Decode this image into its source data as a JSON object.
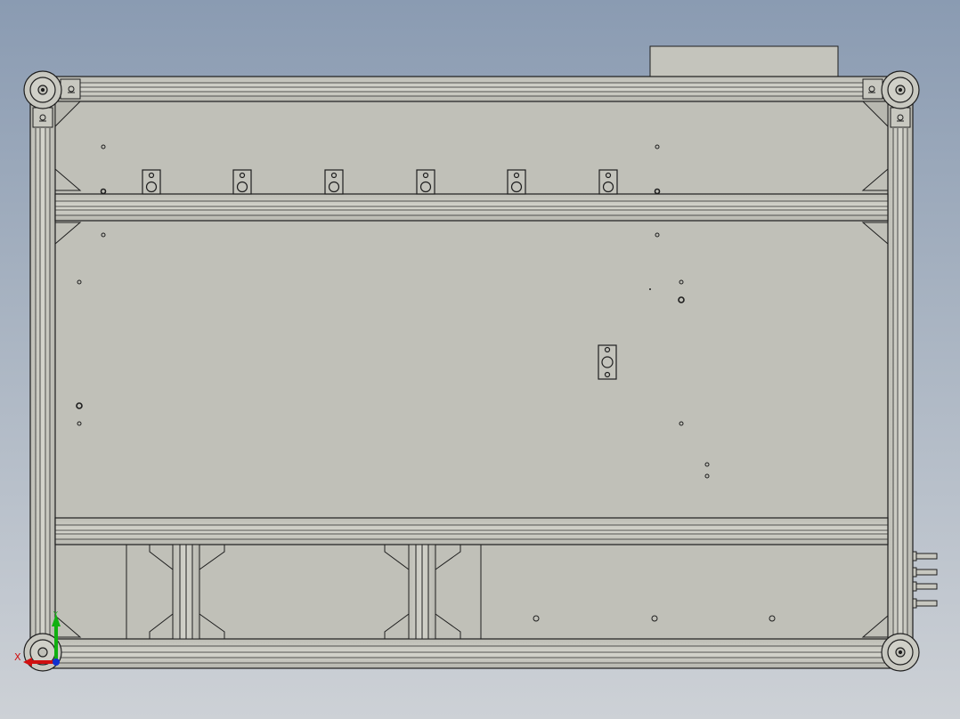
{
  "view": {
    "type": "CAD 3D model viewport - front view of aluminum extrusion frame",
    "colors": {
      "background_top": "#8a9bb2",
      "background_bottom": "#cdd1d6",
      "panel": "#c0c0b8",
      "frame": "#c8c8c0",
      "edge": "#1e1e1e",
      "axis_x": "#d01010",
      "axis_y": "#10b010",
      "axis_z": "#1030d0"
    }
  },
  "triad": {
    "x_label": "X",
    "y_label": "Y",
    "x_icon": "x-axis-arrow-icon",
    "y_icon": "y-axis-arrow-icon",
    "z_icon": "z-axis-dot-icon"
  },
  "parts": {
    "outer_frame": "aluminum-profile-frame",
    "panel": "back-panel",
    "top_box": "top-enclosure-box",
    "crossbars": [
      "upper-crossbar",
      "lower-crossbar"
    ],
    "brackets": "corner-gusset-brackets",
    "feet": "leveling-feet",
    "mounts": "slotted-mount-tabs",
    "bolts": "side-bolts"
  }
}
